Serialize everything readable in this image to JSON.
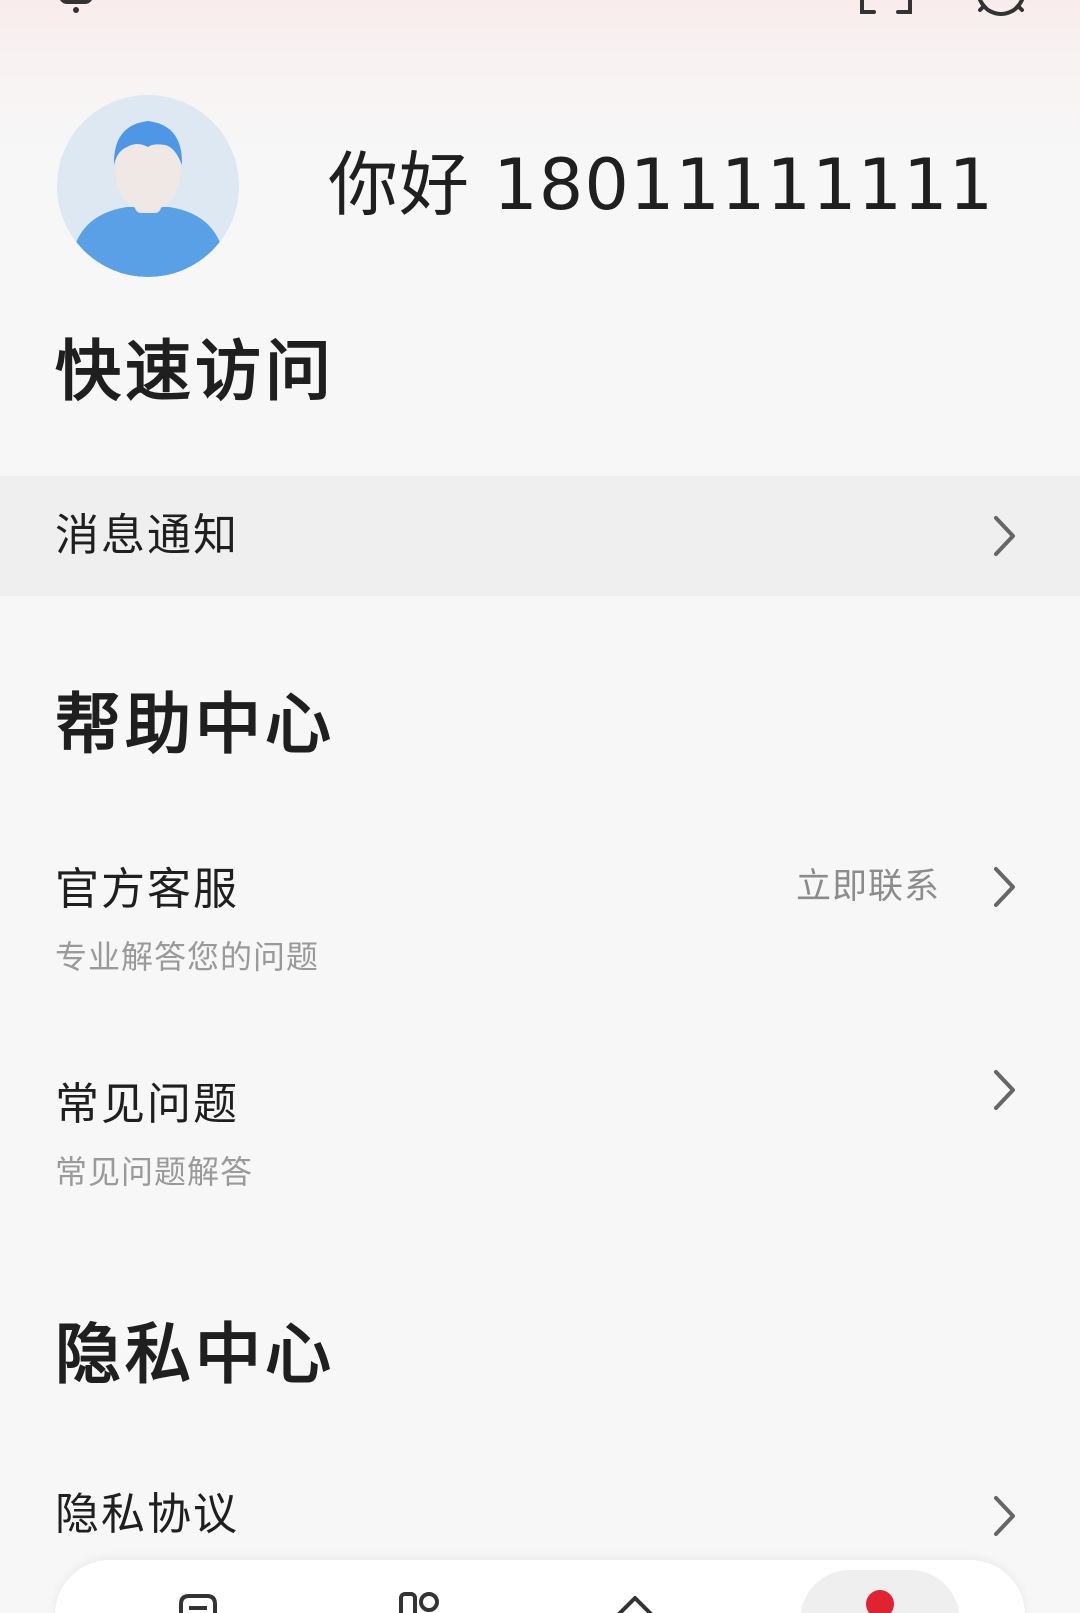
{
  "header": {
    "greeting": "你好 18011111111"
  },
  "icons": {
    "top_left": "robot-icon",
    "scan": "scan-icon",
    "settings": "gear-icon",
    "avatar": "user-avatar"
  },
  "quick_access": {
    "title": "快速访问",
    "items": [
      {
        "label": "消息通知"
      }
    ]
  },
  "help_center": {
    "title": "帮助中心",
    "items": [
      {
        "label": "官方客服",
        "subtitle": "专业解答您的问题",
        "action": "立即联系"
      },
      {
        "label": "常见问题",
        "subtitle": "常见问题解答"
      }
    ]
  },
  "privacy_center": {
    "title": "隐私中心",
    "items": [
      {
        "label": "隐私协议"
      }
    ]
  },
  "bottom_nav": {
    "active_index": 3,
    "accent_color": "#e0242f",
    "items": [
      {
        "icon": "document-icon"
      },
      {
        "icon": "apps-icon"
      },
      {
        "icon": "home-icon"
      },
      {
        "icon": "profile-icon"
      }
    ]
  }
}
